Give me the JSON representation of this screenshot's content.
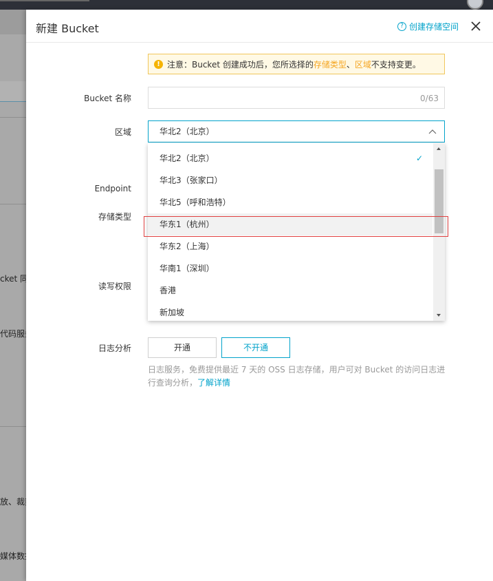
{
  "background": {
    "fragments": [
      "cket 同",
      "代码服务",
      "放、裁剪",
      "媒体数据"
    ]
  },
  "panel": {
    "title": "新建 Bucket",
    "help_label": "创建存储空间",
    "notice": {
      "prefix": "注意：Bucket 创建成功后，您所选择的",
      "highlight1": "存储类型",
      "sep": "、",
      "highlight2": "区域",
      "suffix": "不支持变更。"
    }
  },
  "form": {
    "name_label": "Bucket 名称",
    "name_counter": "0/63",
    "region_label": "区域",
    "region_value": "华北2（北京）",
    "endpoint_label": "Endpoint",
    "storage_label": "存储类型",
    "acl_label": "读写权限",
    "log_label": "日志分析",
    "log_on": "开通",
    "log_off": "不开通",
    "log_desc": "日志服务，免费提供最近 7 天的 OSS 日志存储，用户可对 Bucket 的访问日志进行查询分析，",
    "log_more": "了解详情"
  },
  "dropdown": {
    "selected": "华北2（北京）",
    "options": [
      "华北2（北京）",
      "华北3（张家口）",
      "华北5（呼和浩特）",
      "华东1（杭州）",
      "华东2（上海）",
      "华南1（深圳）",
      "香港",
      "新加坡"
    ]
  },
  "colors": {
    "accent": "#00a2ca",
    "warning": "#f5a623",
    "highlight_border": "#e04040"
  }
}
